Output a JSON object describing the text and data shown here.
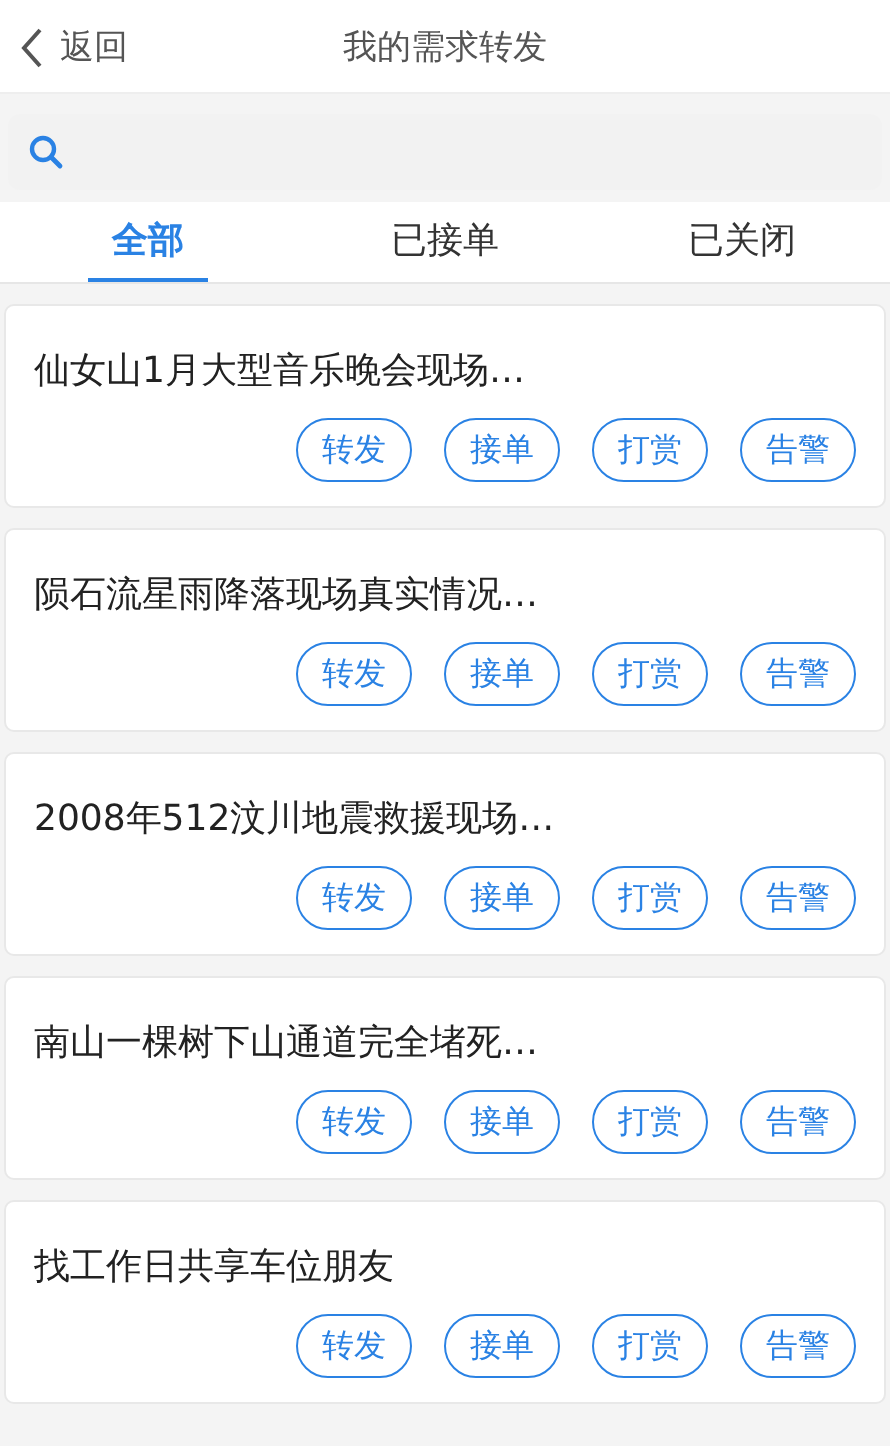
{
  "header": {
    "back": "返回",
    "title": "我的需求转发"
  },
  "tabs": [
    {
      "label": "全部",
      "selected": true
    },
    {
      "label": "已接单",
      "selected": false
    },
    {
      "label": "已关闭",
      "selected": false
    }
  ],
  "items": [
    {
      "title": "仙女山1月大型音乐晚会现场…",
      "actions": [
        "转发",
        "接单",
        "打赏",
        "告警"
      ]
    },
    {
      "title": "陨石流星雨降落现场真实情况…",
      "actions": [
        "转发",
        "接单",
        "打赏",
        "告警"
      ]
    },
    {
      "title": "2008年512汶川地震救援现场…",
      "actions": [
        "转发",
        "接单",
        "打赏",
        "告警"
      ]
    },
    {
      "title": "南山一棵树下山通道完全堵死…",
      "actions": [
        "转发",
        "接单",
        "打赏",
        "告警"
      ]
    },
    {
      "title": "找工作日共享车位朋友",
      "actions": [
        "转发",
        "接单",
        "打赏",
        "告警"
      ]
    }
  ]
}
